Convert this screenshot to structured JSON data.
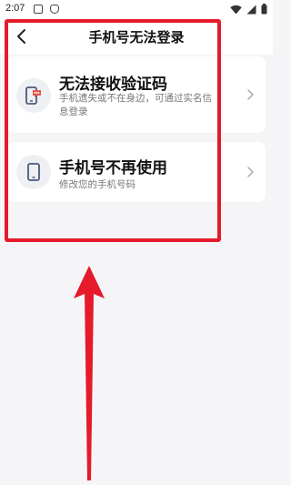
{
  "status_bar": {
    "time": "2:07",
    "left_icons": [
      "app-notification-icon",
      "shield-notification-icon"
    ],
    "right_icons": [
      "wifi-icon",
      "cellular-signal-icon",
      "battery-icon"
    ]
  },
  "header": {
    "title": "手机号无法登录",
    "back_icon": "chevron-left-icon"
  },
  "options": [
    {
      "title": "无法接收验证码",
      "description": "手机遗失或不在身边，可通过实名信息登录",
      "icon": "phone-message-icon"
    },
    {
      "title": "手机号不再使用",
      "description": "修改您的手机号码",
      "icon": "phone-icon"
    }
  ],
  "annotation": {
    "highlight_color": "#e51a2a",
    "arrow_color": "#e51a2a"
  },
  "colors": {
    "page_background": "#f5f5f7",
    "card_background": "#ffffff",
    "icon_circle": "#eef0f4",
    "icon_accent": "#4a5a7a"
  }
}
